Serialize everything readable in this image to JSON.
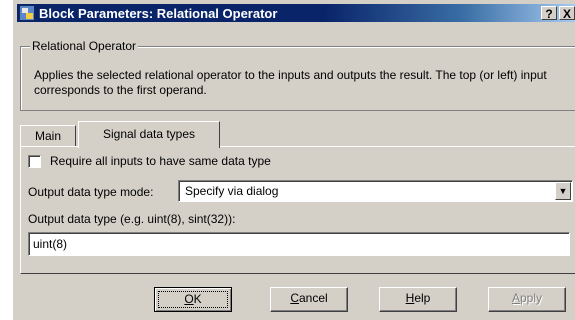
{
  "window": {
    "title": "Block Parameters: Relational Operator",
    "help_button": "?",
    "close_button": "X"
  },
  "group": {
    "legend": "Relational Operator",
    "description": "Applies the selected relational operator to the inputs and outputs the result. The top (or left) input corresponds to the first operand."
  },
  "tabs": [
    {
      "label": "Main",
      "selected": false
    },
    {
      "label": "Signal data types",
      "selected": true
    }
  ],
  "signal_tab": {
    "same_type_checkbox": {
      "label": "Require all inputs to have same data type",
      "checked": false
    },
    "mode": {
      "label": "Output data type mode:",
      "value": "Specify via dialog"
    },
    "output_type": {
      "label": "Output data type (e.g. uint(8), sint(32)):",
      "value": "uint(8)"
    }
  },
  "buttons": {
    "ok": {
      "mnemonic": "O",
      "rest": "K"
    },
    "cancel": {
      "mnemonic": "C",
      "rest": "ancel"
    },
    "help": {
      "mnemonic": "H",
      "rest": "elp"
    },
    "apply": {
      "mnemonic": "A",
      "rest": "pply",
      "enabled": false
    }
  },
  "icons": {
    "app": "simulink-block-icon",
    "dropdown": "chevron-down-icon"
  }
}
